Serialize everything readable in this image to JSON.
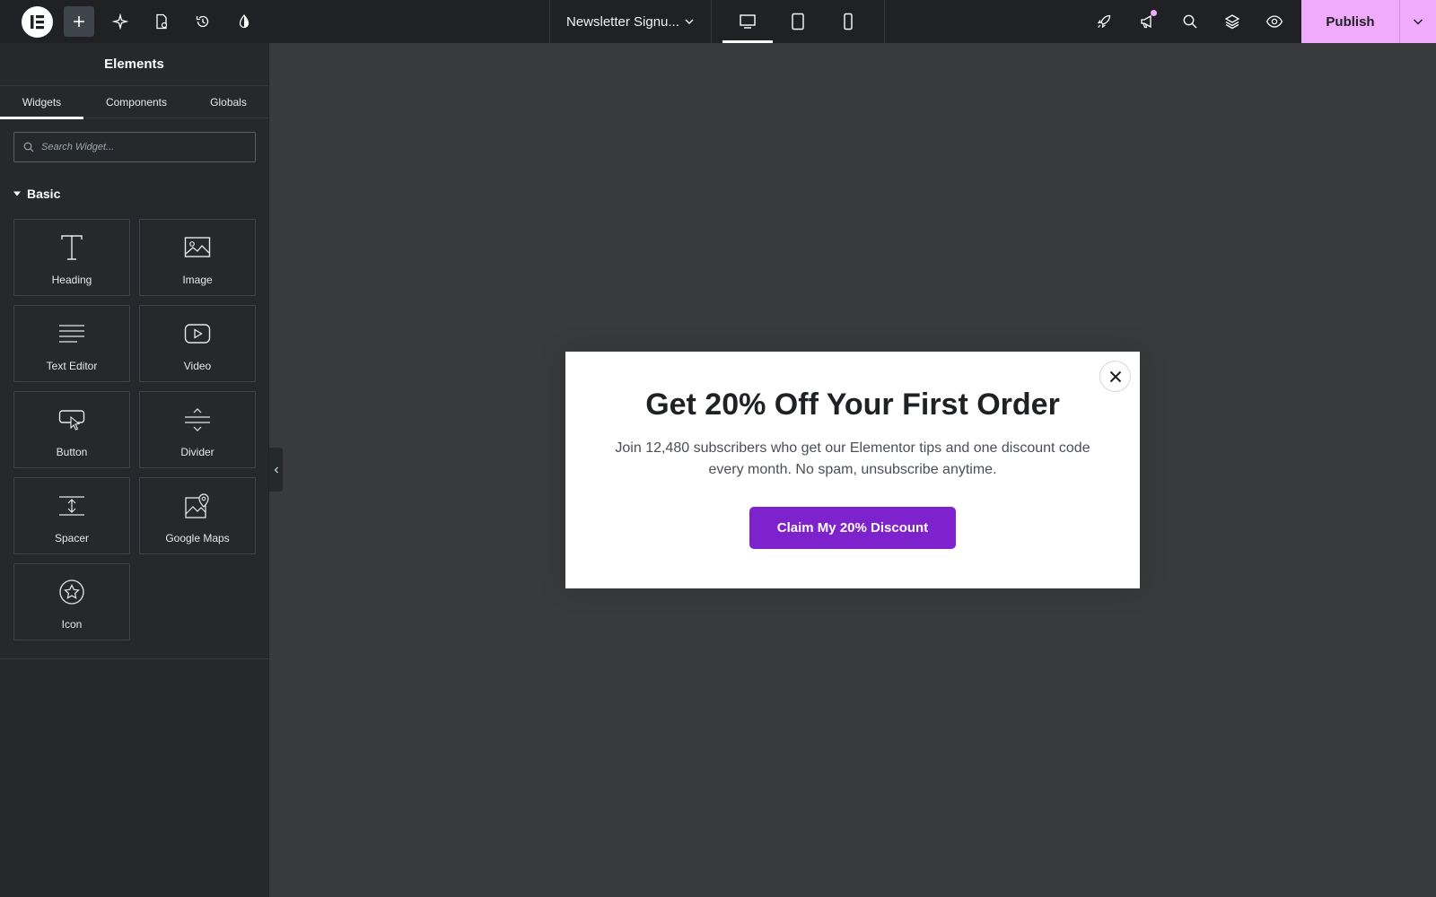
{
  "topbar": {
    "document_title": "Newsletter Signu...",
    "publish_label": "Publish",
    "icons": [
      "elementor-logo-icon",
      "add-element-icon",
      "ai-sparkle-icon",
      "page-settings-icon",
      "history-icon",
      "site-settings-icon",
      "desktop-icon",
      "tablet-icon",
      "mobile-icon",
      "checklist-rocket-icon",
      "notifications-megaphone-icon",
      "finder-search-icon",
      "structure-layers-icon",
      "preview-eye-icon",
      "chevron-down-icon"
    ],
    "accent_color": "#f0abfc"
  },
  "sidebar": {
    "title": "Elements",
    "tabs": [
      {
        "label": "Widgets",
        "active": true
      },
      {
        "label": "Components",
        "active": false
      },
      {
        "label": "Globals",
        "active": false
      }
    ],
    "search": {
      "placeholder": "Search Widget..."
    },
    "section": "Basic",
    "widgets": [
      {
        "label": "Heading",
        "icon": "heading-icon"
      },
      {
        "label": "Image",
        "icon": "image-icon"
      },
      {
        "label": "Text Editor",
        "icon": "text-editor-icon"
      },
      {
        "label": "Video",
        "icon": "video-icon"
      },
      {
        "label": "Button",
        "icon": "button-icon"
      },
      {
        "label": "Divider",
        "icon": "divider-icon"
      },
      {
        "label": "Spacer",
        "icon": "spacer-icon"
      },
      {
        "label": "Google Maps",
        "icon": "google-maps-icon"
      },
      {
        "label": "Icon",
        "icon": "star-icon"
      }
    ]
  },
  "popup": {
    "title": "Get 20% Off Your First Order",
    "text": "Join 12,480 subscribers who get our Elementor tips and one discount code every month. No spam, unsubscribe anytime.",
    "cta": "Claim My 20% Discount",
    "cta_color": "#7e22ce"
  }
}
